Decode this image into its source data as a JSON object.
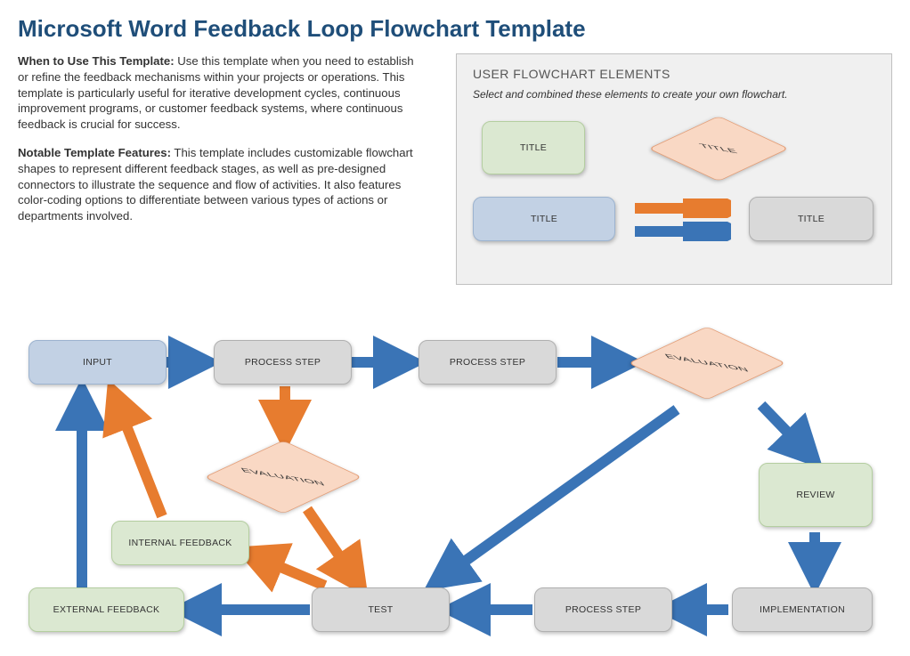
{
  "title": "Microsoft Word Feedback Loop Flowchart Template",
  "section1": {
    "heading": "When to Use This Template:",
    "body": " Use this template when you need to establish or refine the feedback mechanisms within your projects or operations. This template is particularly useful for iterative development cycles, continuous improvement programs, or customer feedback systems, where continuous feedback is crucial for success."
  },
  "section2": {
    "heading": "Notable Template Features:",
    "body": " This template includes customizable flowchart shapes to represent different feedback stages, as well as pre-designed connectors to illustrate the sequence and flow of activities. It also features color-coding options to differentiate between various types of actions or departments involved."
  },
  "panel": {
    "title": "USER FLOWCHART ELEMENTS",
    "subtitle": "Select and combined these elements to create your own flowchart.",
    "el_green": "TITLE",
    "el_peach": "TITLE",
    "el_blue": "TITLE",
    "el_gray": "TITLE"
  },
  "nodes": {
    "input": "INPUT",
    "pstep1": "PROCESS STEP",
    "pstep2": "PROCESS STEP",
    "eval_top": "EVALUATION",
    "eval_left": "EVALUATION",
    "review": "REVIEW",
    "impl": "IMPLEMENTATION",
    "pstep3": "PROCESS STEP",
    "test": "TEST",
    "int_fb": "INTERNAL FEEDBACK",
    "ext_fb": "EXTERNAL FEEDBACK"
  },
  "colors": {
    "blue": "#3a74b6",
    "orange": "#e77c2f"
  }
}
